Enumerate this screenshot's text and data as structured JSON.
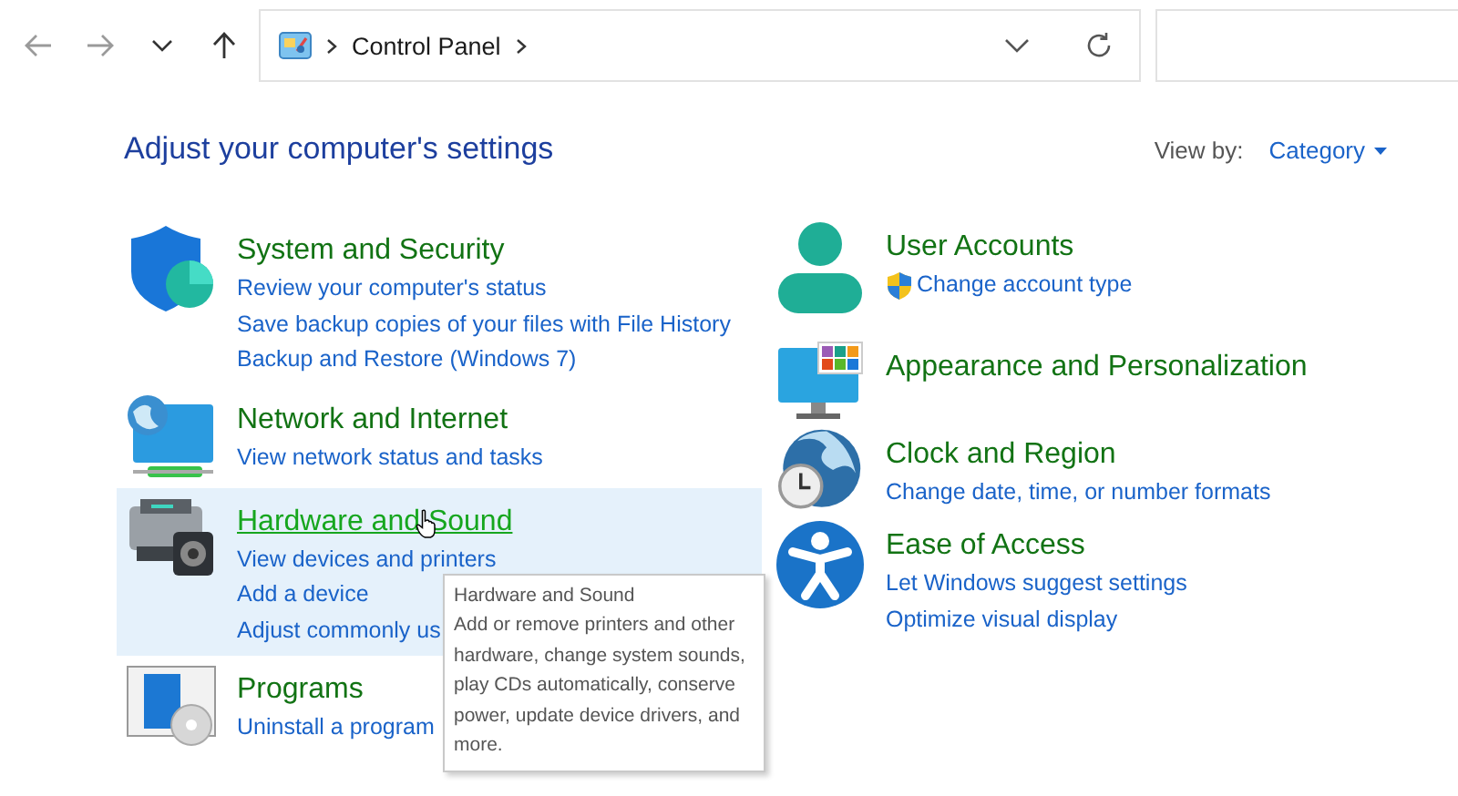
{
  "nav_buttons": [
    {
      "kind": "back",
      "disabled": true
    },
    {
      "kind": "forward",
      "disabled": true
    },
    {
      "kind": "recent",
      "disabled": false
    },
    {
      "kind": "up",
      "disabled": false
    }
  ],
  "address_bar": {
    "breadcrumb": [
      "Control Panel"
    ]
  },
  "heading": "Adjust your computer's settings",
  "view_by": {
    "label": "View by:",
    "value": "Category"
  },
  "columns": [
    [
      {
        "kind": "shield",
        "title": "System and Security",
        "hovered": false,
        "links": [
          {
            "text": "Review your computer's status",
            "shield": false
          },
          {
            "text": "Save backup copies of your files with File History",
            "shield": false
          },
          {
            "text": "Backup and Restore (Windows 7)",
            "shield": false
          }
        ]
      },
      {
        "kind": "network",
        "title": "Network and Internet",
        "hovered": false,
        "links": [
          {
            "text": "View network status and tasks",
            "shield": false
          }
        ]
      },
      {
        "kind": "printer",
        "title": "Hardware and Sound",
        "hovered": true,
        "links": [
          {
            "text": "View devices and printers",
            "shield": false
          },
          {
            "text": "Add a device",
            "shield": false
          },
          {
            "text": "Adjust commonly us",
            "shield": false
          }
        ]
      },
      {
        "kind": "programs",
        "title": "Programs",
        "hovered": false,
        "links": [
          {
            "text": "Uninstall a program",
            "shield": false
          }
        ]
      }
    ],
    [
      {
        "kind": "user",
        "title": "User Accounts",
        "hovered": false,
        "links": [
          {
            "text": "Change account type",
            "shield": true
          }
        ]
      },
      {
        "kind": "monitor",
        "title": "Appearance and Personalization",
        "hovered": false
      },
      {
        "kind": "clock",
        "title": "Clock and Region",
        "hovered": false,
        "links": [
          {
            "text": "Change date, time, or number formats",
            "shield": false
          }
        ]
      },
      {
        "kind": "access",
        "title": "Ease of Access",
        "hovered": false,
        "links": [
          {
            "text": "Let Windows suggest settings",
            "shield": false
          },
          {
            "text": "Optimize visual display",
            "shield": false
          }
        ]
      }
    ]
  ],
  "tooltip": {
    "title": "Hardware and Sound",
    "text": "Add or remove printers and other hardware, change system sounds, play CDs automatically, conserve power, update device drivers, and more."
  }
}
